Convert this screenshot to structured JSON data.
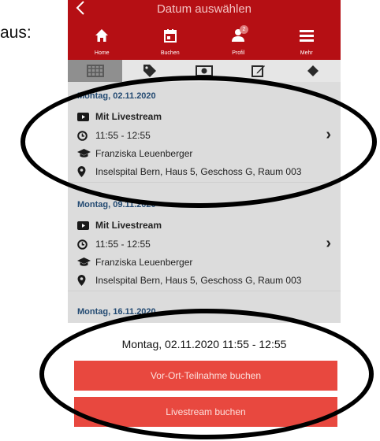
{
  "document": {
    "text": "aus:"
  },
  "header": {
    "back_icon": "chevron-left",
    "title": "Datum auswählen"
  },
  "nav": [
    {
      "icon": "home-icon",
      "label": "Home"
    },
    {
      "icon": "calendar-icon",
      "label": "Buchen"
    },
    {
      "icon": "user-icon",
      "label": "Profil",
      "badge": "2"
    },
    {
      "icon": "menu-icon",
      "label": "Mehr"
    }
  ],
  "tabs": [
    {
      "icon": "grid-icon",
      "active": true
    },
    {
      "icon": "tag-icon",
      "active": false
    },
    {
      "icon": "money-icon",
      "active": false
    },
    {
      "icon": "edit-icon",
      "active": false
    },
    {
      "icon": "diamond-icon",
      "active": false
    }
  ],
  "appointments": [
    {
      "date": "Montag, 02.11.2020",
      "stream": "Mit Livestream",
      "time": "11:55 - 12:55",
      "teacher": "Franziska Leuenberger",
      "location": "Inselspital Bern, Haus 5, Geschoss G, Raum 003"
    },
    {
      "date": "Montag, 09.11.2020",
      "stream": "Mit Livestream",
      "time": "11:55 - 12:55",
      "teacher": "Franziska Leuenberger",
      "location": "Inselspital Bern, Haus 5, Geschoss G, Raum 003"
    }
  ],
  "next_date": "Montag, 16.11.2020",
  "booking": {
    "selected": "Montag, 02.11.2020 11:55 - 12:55",
    "onsite_label": "Vor-Ort-Teilnahme buchen",
    "livestream_label": "Livestream buchen"
  },
  "colors": {
    "header": "#b50f14",
    "button": "#e8483f",
    "date_text": "#234a72"
  }
}
